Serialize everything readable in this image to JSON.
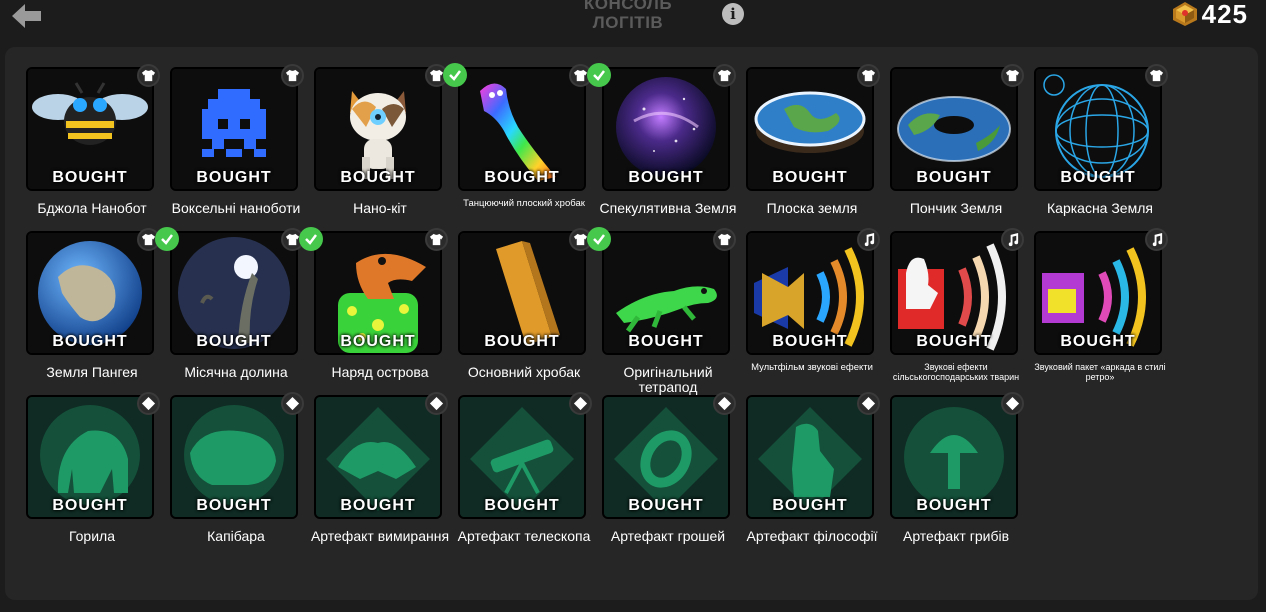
{
  "header": {
    "title": "КОНСОЛЬ ЛОГІТІВ",
    "gems": "425"
  },
  "items": [
    {
      "label": "Бджола Нанобот",
      "status": "BOUGHT",
      "badge": "shirt-icon",
      "checked": false,
      "art": "bee"
    },
    {
      "label": "Воксельні наноботи",
      "status": "BOUGHT",
      "badge": "shirt-icon",
      "checked": false,
      "art": "invader"
    },
    {
      "label": "Нано-кіт",
      "status": "BOUGHT",
      "badge": "shirt-icon",
      "checked": false,
      "art": "cat"
    },
    {
      "label": "Танцюючий плоский хробак",
      "status": "BOUGHT",
      "badge": "shirt-icon",
      "checked": true,
      "art": "worm"
    },
    {
      "label": "Спекулятивна Земля",
      "status": "BOUGHT",
      "badge": "shirt-icon",
      "checked": true,
      "art": "galaxy"
    },
    {
      "label": "Плоска земля",
      "status": "BOUGHT",
      "badge": "shirt-icon",
      "checked": false,
      "art": "flat"
    },
    {
      "label": "Пончик Земля",
      "status": "BOUGHT",
      "badge": "shirt-icon",
      "checked": false,
      "art": "donut"
    },
    {
      "label": "Каркасна Земля",
      "status": "BOUGHT",
      "badge": "shirt-icon",
      "checked": false,
      "art": "wire"
    },
    {
      "label": "Земля Пангея",
      "status": "BOUGHT",
      "badge": "shirt-icon",
      "checked": false,
      "art": "pangea"
    },
    {
      "label": "Місячна долина",
      "status": "BOUGHT",
      "badge": "shirt-icon",
      "checked": true,
      "art": "moon"
    },
    {
      "label": "Наряд острова",
      "status": "BOUGHT",
      "badge": "shirt-icon",
      "checked": true,
      "art": "dino"
    },
    {
      "label": "Основний хробак",
      "status": "BOUGHT",
      "badge": "shirt-icon",
      "checked": false,
      "art": "block"
    },
    {
      "label": "Оригінальний тетрапод",
      "status": "BOUGHT",
      "badge": "shirt-icon",
      "checked": true,
      "art": "lizard"
    },
    {
      "label": "Мультфільм звукові ефекти",
      "status": "BOUGHT",
      "badge": "music-icon",
      "checked": false,
      "art": "sound-horn"
    },
    {
      "label": "Звукові ефекти сільськогосподарських тварин",
      "status": "BOUGHT",
      "badge": "music-icon",
      "checked": false,
      "art": "sound-goose"
    },
    {
      "label": "Звуковий пакет «аркада в стилі ретро»",
      "status": "BOUGHT",
      "badge": "music-icon",
      "checked": false,
      "art": "sound-arcade"
    },
    {
      "label": "Горила",
      "status": "BOUGHT",
      "badge": "diamond-icon",
      "checked": false,
      "art": "gorilla"
    },
    {
      "label": "Капібара",
      "status": "BOUGHT",
      "badge": "diamond-icon",
      "checked": false,
      "art": "capybara"
    },
    {
      "label": "Артефакт вимирання",
      "status": "BOUGHT",
      "badge": "diamond-icon",
      "checked": false,
      "art": "extinction"
    },
    {
      "label": "Артефакт телескопа",
      "status": "BOUGHT",
      "badge": "diamond-icon",
      "checked": false,
      "art": "telescope"
    },
    {
      "label": "Артефакт грошей",
      "status": "BOUGHT",
      "badge": "diamond-icon",
      "checked": false,
      "art": "coin"
    },
    {
      "label": "Артефакт філософії",
      "status": "BOUGHT",
      "badge": "diamond-icon",
      "checked": false,
      "art": "thinker"
    },
    {
      "label": "Артефакт грибів",
      "status": "BOUGHT",
      "badge": "diamond-icon",
      "checked": false,
      "art": "mushroom"
    }
  ]
}
